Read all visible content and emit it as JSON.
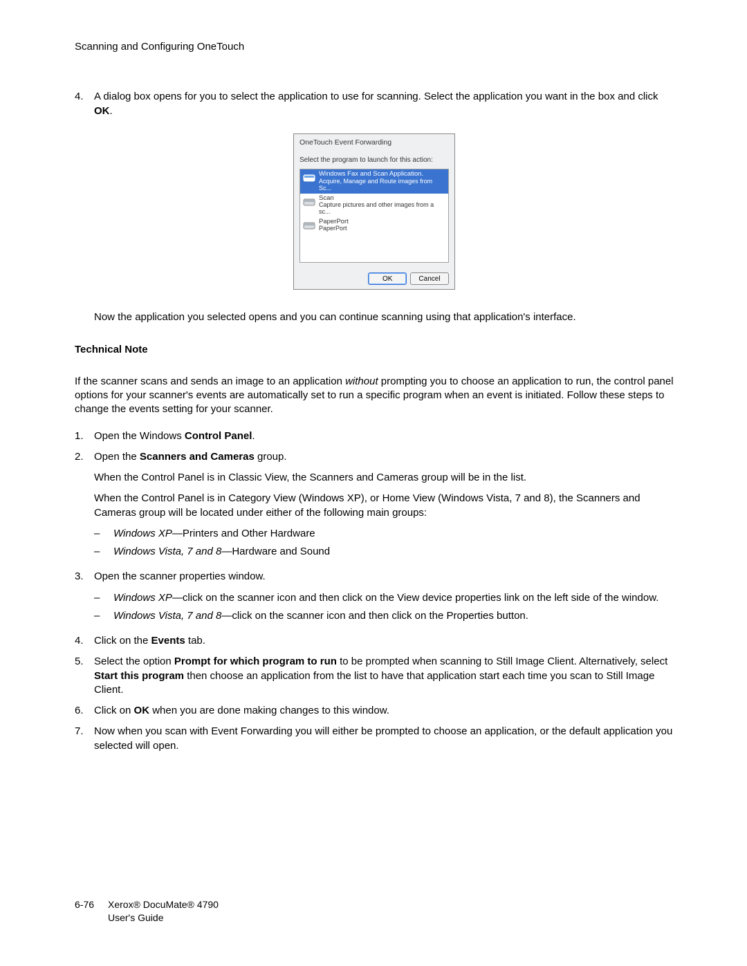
{
  "header_title": "Scanning and Configuring OneTouch",
  "step4": {
    "number": "4.",
    "text_a": "A dialog box opens for you to select the application to use for scanning. Select the application you want in the box and click ",
    "text_b": "OK",
    "text_c": "."
  },
  "dialog": {
    "title": "OneTouch Event Forwarding",
    "prompt": "Select the program to launch for this action:",
    "items": [
      {
        "name": "Windows Fax and Scan Application.",
        "sub": "Acquire, Manage and Route images from Sc..."
      },
      {
        "name": "Scan",
        "sub": "Capture pictures and other images from a sc..."
      },
      {
        "name": "PaperPort",
        "sub": "PaperPort"
      }
    ],
    "ok": "OK",
    "cancel": "Cancel"
  },
  "after_dialog": "Now the application you selected opens and you can continue scanning using that application's interface.",
  "tech_note_title": "Technical Note",
  "tech_note_para_a": "If the scanner scans and sends an image to an application ",
  "tech_note_para_b": "without",
  "tech_note_para_c": " prompting you to choose an application to run, the control panel options for your scanner's events are automatically set to run a specific program when an event is initiated. Follow these steps to change the events setting for your scanner.",
  "s1": {
    "n": "1.",
    "a": "Open the Windows ",
    "b": "Control Panel",
    "c": "."
  },
  "s2": {
    "n": "2.",
    "a": "Open the ",
    "b": "Scanners and Cameras",
    "c": " group."
  },
  "s2p1": "When the Control Panel is in Classic View, the Scanners and Cameras group will be in the list.",
  "s2p2": "When the Control Panel is in Category View (Windows XP), or Home View (Windows Vista, 7 and 8), the Scanners and Cameras group will be located under either of the following main groups:",
  "s2d1_i": "Windows XP",
  "s2d1_t": "—Printers and Other Hardware",
  "s2d2_i": "Windows Vista, 7 and 8",
  "s2d2_t": "—Hardware and Sound",
  "s3": {
    "n": "3.",
    "t": "Open the scanner properties window."
  },
  "s3d1_i": "Windows XP",
  "s3d1_t": "—click on the scanner icon and then click on the View device properties link on the left side of the window.",
  "s3d2_i": "Windows Vista, 7 and 8",
  "s3d2_t": "—click on the scanner icon and then click on the Properties button.",
  "s4": {
    "n": "4.",
    "a": "Click on the ",
    "b": "Events",
    "c": " tab."
  },
  "s5": {
    "n": "5.",
    "a": "Select the option ",
    "b": "Prompt for which program to run",
    "c": " to be prompted when scanning to Still Image Client. Alternatively, select ",
    "d": "Start this program",
    "e": " then choose an application from the list to have that application start each time you scan to Still Image Client."
  },
  "s6": {
    "n": "6.",
    "a": "Click on ",
    "b": "OK",
    "c": " when you are done making changes to this window."
  },
  "s7": {
    "n": "7.",
    "t": "Now when you scan with Event Forwarding you will either be prompted to choose an application, or the default application you selected will open."
  },
  "footer": {
    "page_num": "6-76",
    "line1": "Xerox® DocuMate® 4790",
    "line2": "User's Guide"
  }
}
